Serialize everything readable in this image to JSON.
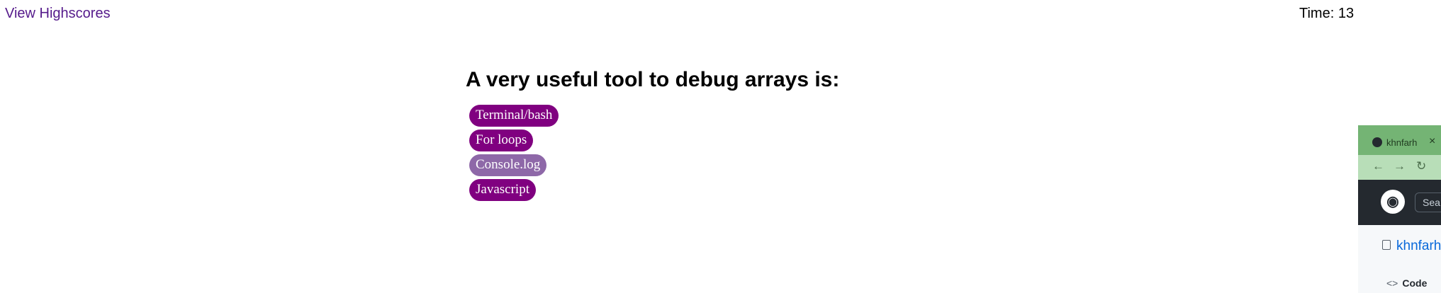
{
  "header": {
    "highscores_label": "View Highscores",
    "timer_text": "Time: 13"
  },
  "quiz": {
    "question": "A very useful tool to debug arrays is:",
    "answers": [
      {
        "label": "Terminal/bash",
        "selected": false
      },
      {
        "label": "For loops",
        "selected": false
      },
      {
        "label": "Console.log",
        "selected": true
      },
      {
        "label": "Javascript",
        "selected": false
      }
    ],
    "colors": {
      "answer_bg": "#800080",
      "answer_hover_bg": "#8e68a8"
    }
  },
  "overlay_window": {
    "tab_title": "khnfarh",
    "tab_close": "×",
    "search_placeholder": "Sea",
    "repo_name": "khnfarh",
    "code_tab": "Code",
    "icons": [
      "github-icon",
      "close-icon",
      "back-arrow-icon",
      "forward-arrow-icon",
      "reload-icon",
      "repo-icon",
      "code-icon"
    ]
  }
}
